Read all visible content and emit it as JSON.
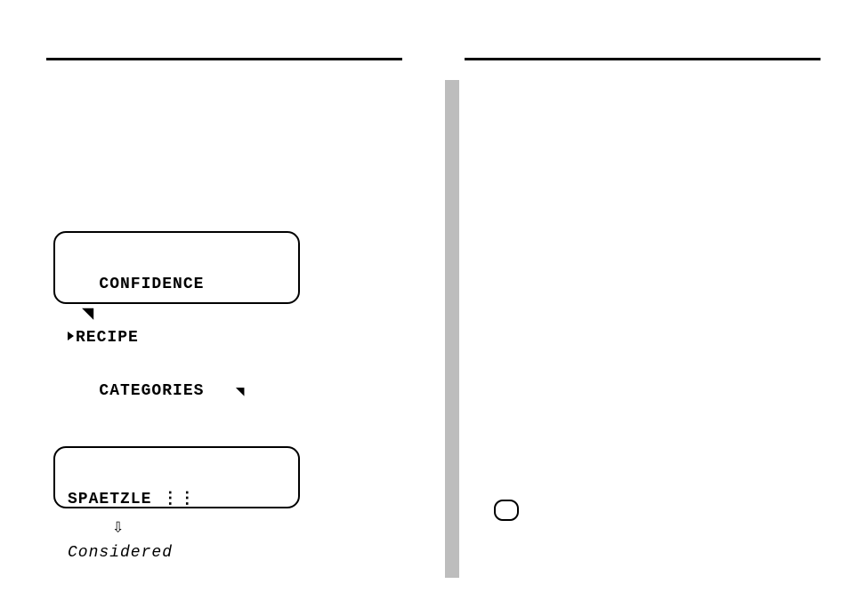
{
  "left": {
    "lcd1": {
      "line1": "CONFIDENCE",
      "line2": "RECIPE",
      "line3": "CATEGORIES",
      "corner_glyph": "◥"
    },
    "arrow_below_lcd1": "◥",
    "lcd2": {
      "line1_strong": "SPAETZLE",
      "line1_glyph": "⋮⋮",
      "line2_italic": "Considered"
    },
    "arrow_below_lcd2": "⇩"
  },
  "right": {
    "pill_label": ""
  }
}
